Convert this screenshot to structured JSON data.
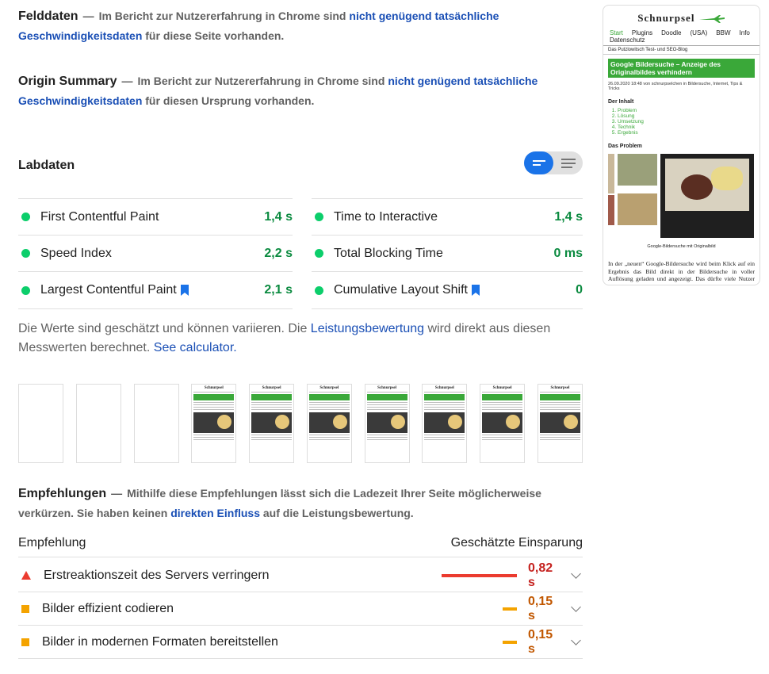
{
  "field_data": {
    "heading": "Felddaten",
    "text_before": "Im Bericht zur Nutzererfahrung in Chrome sind",
    "link": "nicht genügend tatsächliche Geschwindigkeitsdaten",
    "text_after": "für diese Seite vorhanden."
  },
  "origin_summary": {
    "heading": "Origin Summary",
    "text_before": "Im Bericht zur Nutzererfahrung in Chrome sind",
    "link": "nicht genügend tatsächliche Geschwindigkeitsdaten",
    "text_after": "für diesen Ursprung vorhanden."
  },
  "lab_data": {
    "heading": "Labdaten",
    "metrics_left": [
      {
        "name": "First Contentful Paint",
        "value": "1,4 s",
        "bookmark": false
      },
      {
        "name": "Speed Index",
        "value": "2,2 s",
        "bookmark": false
      },
      {
        "name": "Largest Contentful Paint",
        "value": "2,1 s",
        "bookmark": true
      }
    ],
    "metrics_right": [
      {
        "name": "Time to Interactive",
        "value": "1,4 s",
        "bookmark": false
      },
      {
        "name": "Total Blocking Time",
        "value": "0 ms",
        "bookmark": false
      },
      {
        "name": "Cumulative Layout Shift",
        "value": "0",
        "bookmark": true
      }
    ],
    "status_color": "#0cce6b",
    "note_before": "Die Werte sind geschätzt und können variieren. Die",
    "note_link": "Leistungsbewertung",
    "note_after": "wird direkt aus diesen Messwerten berechnet.",
    "calculator_link": "See calculator."
  },
  "filmstrip": {
    "blank_frames": 3,
    "loaded_frames": 7,
    "mini_logo": "Schnurpsel"
  },
  "recommendations": {
    "heading": "Empfehlungen",
    "desc_before": "Mithilfe diese Empfehlungen lässt sich die Ladezeit Ihrer Seite möglicherweise verkürzen. Sie haben keinen",
    "desc_link": "direkten Einfluss",
    "desc_after": "auf die Leistungsbewertung.",
    "col_left": "Empfehlung",
    "col_right": "Geschätzte Einsparung",
    "items": [
      {
        "title": "Erstreaktionszeit des Servers verringern",
        "saving": "0,82 s",
        "severity": "fail",
        "color": "#eb3b2f"
      },
      {
        "title": "Bilder effizient codieren",
        "saving": "0,15 s",
        "severity": "average",
        "color": "#f4a300"
      },
      {
        "title": "Bilder in modernen Formaten bereitstellen",
        "saving": "0,15 s",
        "severity": "average",
        "color": "#f4a300"
      }
    ]
  },
  "screenshot": {
    "logo": "Schnurpsel",
    "nav": [
      "Start",
      "Plugins",
      "Doodle",
      "(USA)",
      "BBW",
      "Info",
      "Datenschutz"
    ],
    "tagline": "Das Putzlowitsch Test- und SEO-Blog",
    "post_title": "Google Bildersuche – Anzeige des Originalbildes verhindern",
    "meta": "26.09.2020 18:48 von schnurpselchen in Bildersuche, Internet, Tips & Tricks",
    "toc_heading": "Der Inhalt",
    "toc": [
      "Problem",
      "Lösung",
      "Umsetzung",
      "Technik",
      "Ergebnis"
    ],
    "problem_heading": "Das Problem",
    "caption": "Google-Bildersuche mit Originalbild",
    "paragraph": "In der „neuen“ Google-Bildersuche wird beim Klick auf ein Ergebnis das Bild direkt in der Bildersuche in voller Auflösung geladen und angezeigt. Das dürfte viele Nutzer davon abhalten, die Ursprungsseite zu besuchen."
  }
}
